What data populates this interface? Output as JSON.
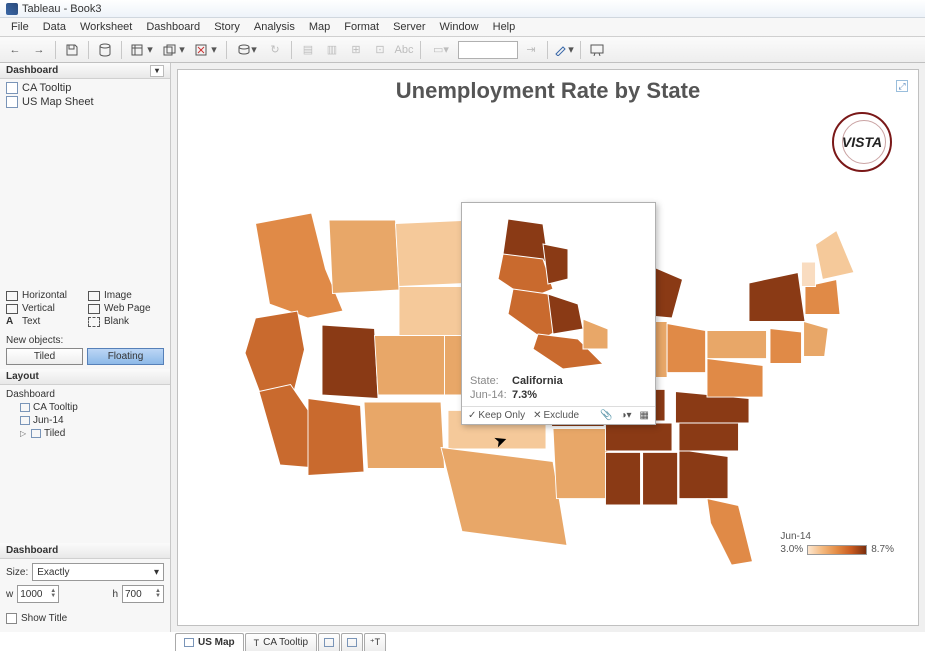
{
  "window": {
    "title": "Tableau - Book3"
  },
  "menubar": [
    "File",
    "Data",
    "Worksheet",
    "Dashboard",
    "Story",
    "Analysis",
    "Map",
    "Format",
    "Server",
    "Window",
    "Help"
  ],
  "sidebar": {
    "dash_header": "Dashboard",
    "sheets": {
      "ca_tooltip": "CA Tooltip",
      "us_map_sheet": "US Map Sheet"
    },
    "objects": {
      "horizontal": "Horizontal",
      "image": "Image",
      "vertical": "Vertical",
      "webpage": "Web Page",
      "text": "Text",
      "blank": "Blank"
    },
    "newobj_label": "New objects:",
    "tiled": "Tiled",
    "floating": "Floating",
    "layout_header": "Layout",
    "tree": {
      "root": "Dashboard",
      "ca": "CA Tooltip",
      "jun": "Jun-14",
      "tiled": "Tiled"
    },
    "size_header": "Dashboard",
    "size_label": "Size:",
    "size_mode": "Exactly",
    "w_label": "w",
    "w_val": "1000",
    "h_label": "h",
    "h_val": "700",
    "show_title": "Show Title"
  },
  "chart": {
    "title": "Unemployment Rate by State",
    "logo_text": "VISTA",
    "legend_label": "Jun-14",
    "legend_min": "3.0%",
    "legend_max": "8.7%"
  },
  "tooltip": {
    "state_k": "State:",
    "state_v": "California",
    "date_k": "Jun-14:",
    "date_v": "7.3%",
    "keep": "Keep Only",
    "exclude": "Exclude"
  },
  "tabs": {
    "us_map": "US Map",
    "ca_tooltip": "CA Tooltip"
  },
  "chart_data": {
    "type": "heatmap",
    "title": "Unemployment Rate by State",
    "series_label": "Jun-14",
    "value_range": [
      3.0,
      8.7
    ],
    "unit": "%",
    "highlighted": {
      "state": "California",
      "value": 7.3
    },
    "note": "US choropleth map; sequential orange-brown scale from 3.0% (light) to 8.7% (dark). Exact per-state values not labeled; California tooltip shows 7.3%."
  }
}
